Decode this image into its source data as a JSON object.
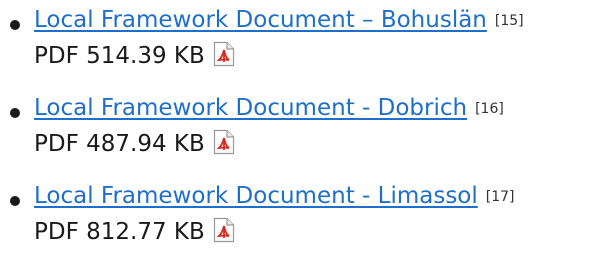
{
  "documents": [
    {
      "title": "Local Framework Document – Bohuslän",
      "ref": "[15]",
      "file_info": "PDF 514.39 KB",
      "icon": "pdf-file-icon"
    },
    {
      "title": "Local Framework Document - Dobrich",
      "ref": "[16]",
      "file_info": "PDF 487.94 KB",
      "icon": "pdf-file-icon"
    },
    {
      "title": "Local Framework Document - Limassol",
      "ref": "[17]",
      "file_info": "PDF 812.77 KB",
      "icon": "pdf-file-icon"
    }
  ],
  "colors": {
    "link": "#1f6fc9",
    "text": "#1a1a1a",
    "pdf_icon_accent": "#d62b1f"
  }
}
